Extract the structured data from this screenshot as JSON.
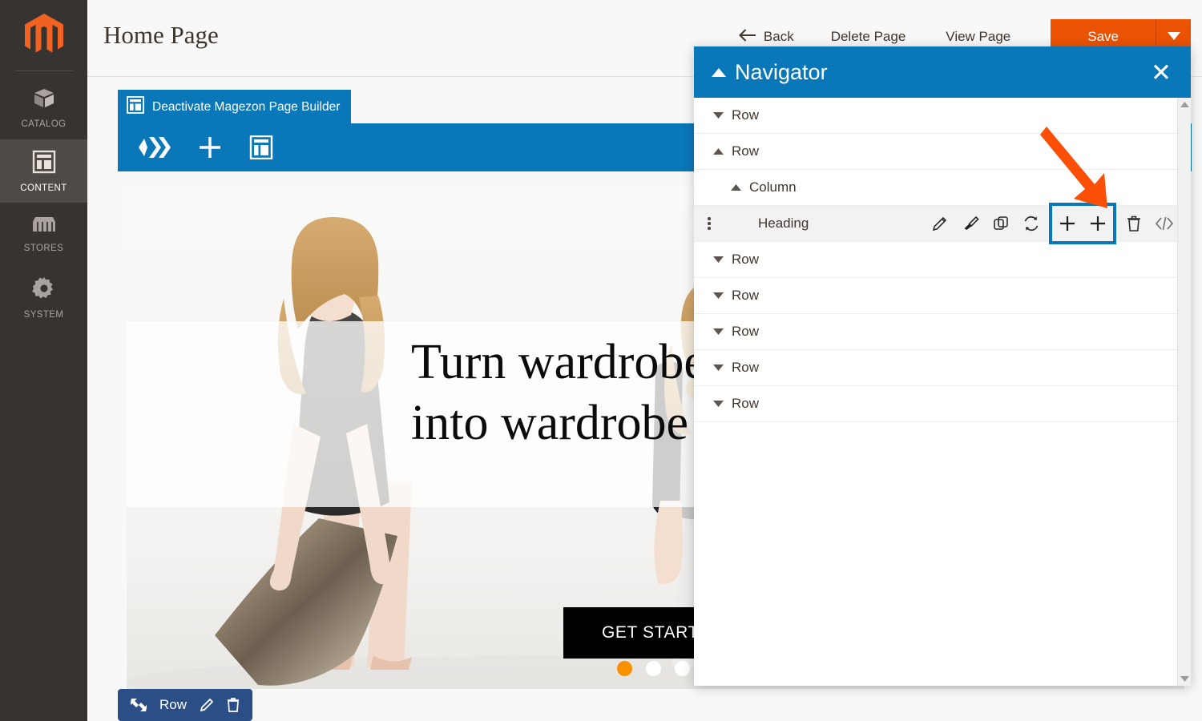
{
  "colors": {
    "magento_orange": "#eb5202",
    "pb_blue": "#0a77b8",
    "sidebar_dark": "#373330",
    "row_badge_blue": "#2b4e87",
    "annotation_orange": "#fb4f07",
    "dot_active": "#f79100"
  },
  "sidebar": {
    "logo_name": "magento-logo",
    "items": [
      {
        "label": "CATALOG",
        "icon": "box-icon",
        "active": false
      },
      {
        "label": "CONTENT",
        "icon": "layout-icon",
        "active": true
      },
      {
        "label": "STORES",
        "icon": "store-icon",
        "active": false
      },
      {
        "label": "SYSTEM",
        "icon": "gear-icon",
        "active": false
      }
    ]
  },
  "header": {
    "title": "Home Page",
    "back_label": "Back",
    "back_icon": "arrow-left-icon",
    "delete_label": "Delete Page",
    "view_label": "View Page",
    "save_label": "Save",
    "save_caret_icon": "caret-down-icon"
  },
  "pagebuilder": {
    "deactivate_label": "Deactivate Magezon Page Builder",
    "deactivate_icon": "layout-icon",
    "toolbar_icons": [
      "magezon-chevrons-icon",
      "plus-icon",
      "layout-icon"
    ]
  },
  "hero": {
    "headline_line1": "Turn wardrobe",
    "headline_line2": "into wardrobe",
    "cta_label": "GET STARTED",
    "dots": [
      {
        "active": true
      },
      {
        "active": false
      },
      {
        "active": false
      }
    ]
  },
  "row_badge": {
    "move_icon": "move-icon",
    "label": "Row",
    "edit_icon": "pencil-icon",
    "delete_icon": "trash-icon"
  },
  "navigator": {
    "title": "Navigator",
    "collapse_icon": "caret-up-icon",
    "close_icon": "close-icon",
    "tree": [
      {
        "label": "Row",
        "indent": 0,
        "caret": "down",
        "type": "row",
        "selected": false
      },
      {
        "label": "Row",
        "indent": 0,
        "caret": "up",
        "type": "row",
        "selected": false
      },
      {
        "label": "Column",
        "indent": 1,
        "caret": "up",
        "type": "column",
        "selected": false
      },
      {
        "label": "Heading",
        "indent": 2,
        "caret": "none",
        "type": "element",
        "selected": true
      },
      {
        "label": "Row",
        "indent": 0,
        "caret": "down",
        "type": "row",
        "selected": false
      },
      {
        "label": "Row",
        "indent": 0,
        "caret": "down",
        "type": "row",
        "selected": false
      },
      {
        "label": "Row",
        "indent": 0,
        "caret": "down",
        "type": "row",
        "selected": false
      },
      {
        "label": "Row",
        "indent": 0,
        "caret": "down",
        "type": "row",
        "selected": false
      },
      {
        "label": "Row",
        "indent": 0,
        "caret": "down",
        "type": "row",
        "selected": false
      }
    ],
    "element_actions": [
      {
        "name": "edit-icon",
        "highlighted": false
      },
      {
        "name": "style-brush-icon",
        "highlighted": false
      },
      {
        "name": "duplicate-icon",
        "highlighted": false
      },
      {
        "name": "replace-icon",
        "highlighted": false
      },
      {
        "name": "add-before-icon",
        "highlighted": true
      },
      {
        "name": "add-after-icon",
        "highlighted": true
      },
      {
        "name": "trash-icon",
        "highlighted": false
      },
      {
        "name": "code-icon",
        "highlighted": false
      }
    ],
    "scrollbar": {
      "up_icon": "scroll-up-icon",
      "down_icon": "scroll-down-icon"
    }
  },
  "annotation": {
    "arrow_icon": "annotation-arrow-icon"
  }
}
